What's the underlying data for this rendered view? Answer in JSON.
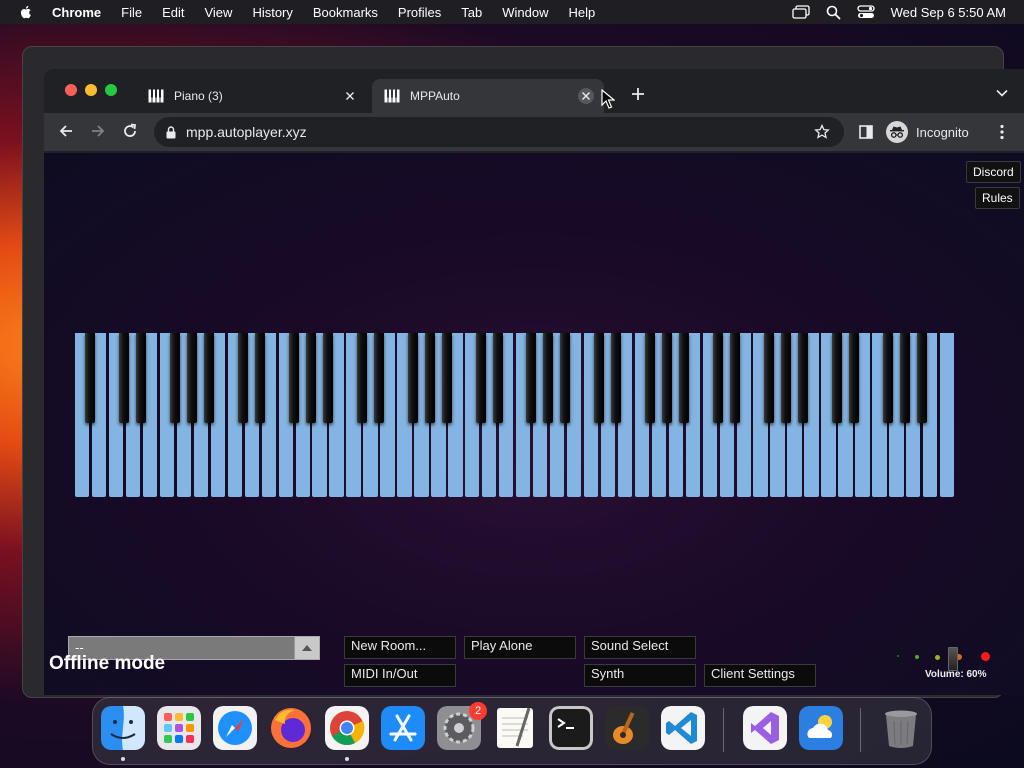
{
  "menubar": {
    "app_name": "Chrome",
    "items": [
      "File",
      "Edit",
      "View",
      "History",
      "Bookmarks",
      "Profiles",
      "Tab",
      "Window",
      "Help"
    ],
    "clock": "Wed Sep 6  5:50 AM"
  },
  "browser": {
    "tabs": [
      {
        "title": "Piano (3)"
      },
      {
        "title": "MPPAuto"
      }
    ],
    "url": "mpp.autoplayer.xyz",
    "profile_label": "Incognito"
  },
  "page": {
    "links": {
      "discord": "Discord",
      "rules": "Rules"
    },
    "room_select_value": "--",
    "buttons": {
      "new_room": "New Room...",
      "play_alone": "Play Alone",
      "sound_select": "Sound Select",
      "midi": "MIDI In/Out",
      "synth": "Synth",
      "client_settings": "Client Settings"
    },
    "status": "Offline mode",
    "volume_label": "Volume: 60%",
    "volume": 0.6
  },
  "dock": {
    "apps": [
      "finder-icon",
      "launchpad-icon",
      "safari-icon",
      "firefox-icon",
      "chrome-icon",
      "app-store-icon",
      "system-settings-icon",
      "textedit-icon",
      "terminal-icon",
      "garageband-icon",
      "vscode-icon",
      "visual-studio-icon",
      "weather-icon",
      "trash-icon"
    ],
    "settings_badge": "2"
  },
  "colors": {
    "white_key": "#83b4e2",
    "accent_close": "#ff5f57",
    "accent_min": "#febc2e",
    "accent_max": "#28c840"
  }
}
